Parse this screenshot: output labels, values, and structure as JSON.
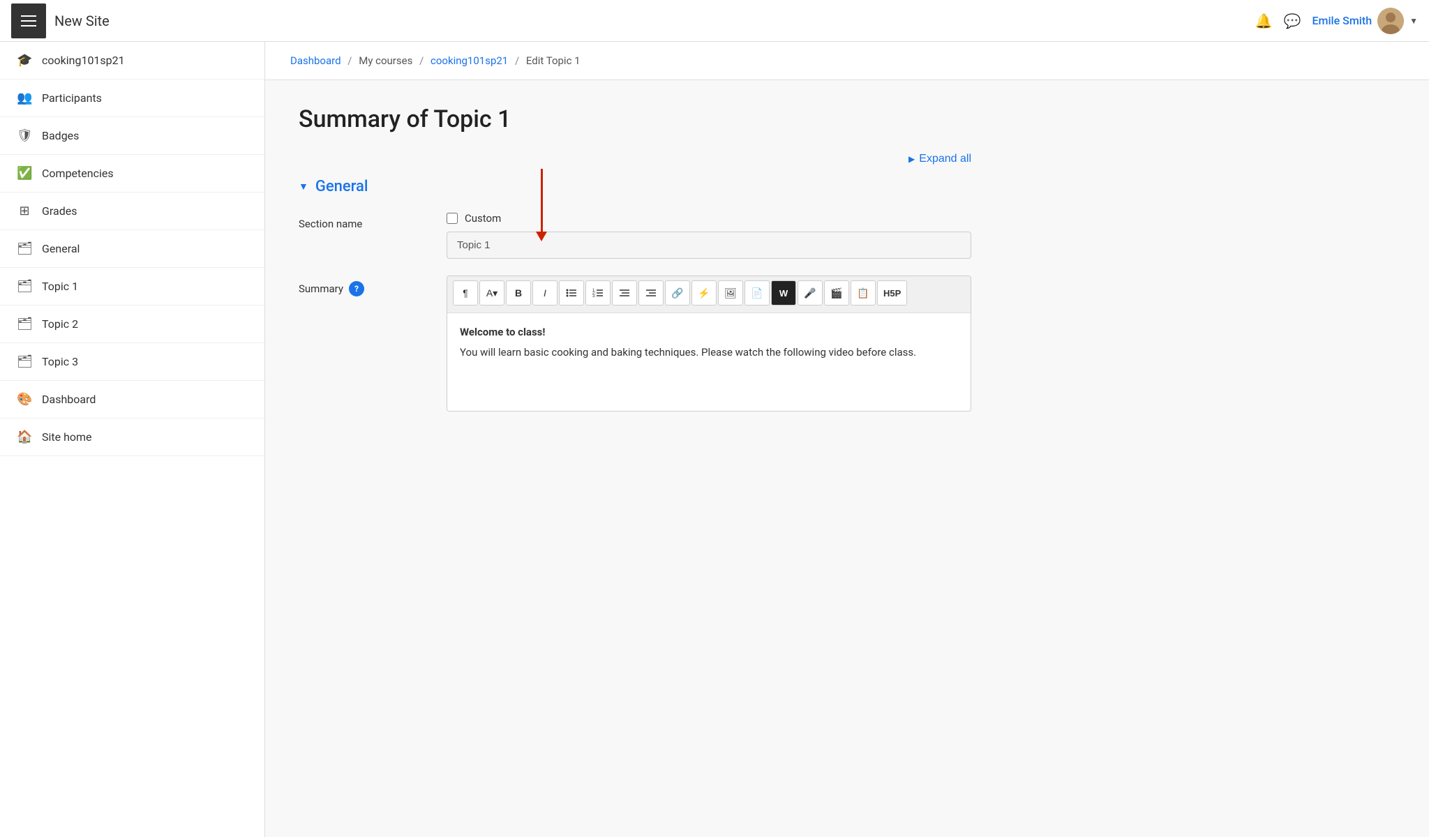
{
  "topbar": {
    "site_title": "New Site",
    "user_name": "Emile Smith",
    "notification_icon": "🔔",
    "message_icon": "💬",
    "dropdown_arrow": "▼"
  },
  "sidebar": {
    "items": [
      {
        "id": "cooking101sp21",
        "label": "cooking101sp21",
        "icon": "🎓"
      },
      {
        "id": "participants",
        "label": "Participants",
        "icon": "👥"
      },
      {
        "id": "badges",
        "label": "Badges",
        "icon": "🛡"
      },
      {
        "id": "competencies",
        "label": "Competencies",
        "icon": "✅"
      },
      {
        "id": "grades",
        "label": "Grades",
        "icon": "⊞"
      },
      {
        "id": "general",
        "label": "General",
        "icon": "🗂"
      },
      {
        "id": "topic1",
        "label": "Topic 1",
        "icon": "🗂"
      },
      {
        "id": "topic2",
        "label": "Topic 2",
        "icon": "🗂"
      },
      {
        "id": "topic3",
        "label": "Topic 3",
        "icon": "🗂"
      },
      {
        "id": "dashboard",
        "label": "Dashboard",
        "icon": "🎨"
      },
      {
        "id": "sitehome",
        "label": "Site home",
        "icon": "🏠"
      }
    ]
  },
  "breadcrumb": {
    "items": [
      {
        "label": "Dashboard",
        "href": "#",
        "link": true
      },
      {
        "label": "My courses",
        "href": "#",
        "link": false
      },
      {
        "label": "cooking101sp21",
        "href": "#",
        "link": true
      },
      {
        "label": "Edit Topic 1",
        "href": "#",
        "link": false
      }
    ]
  },
  "page": {
    "title": "Summary of Topic 1",
    "expand_all_label": "Expand all",
    "section_title": "General",
    "form": {
      "section_name_label": "Section name",
      "custom_label": "Custom",
      "section_input_value": "Topic 1",
      "summary_label": "Summary",
      "editor_content_bold": "Welcome to class!",
      "editor_content_normal": "You will learn basic cooking and baking techniques. Please watch the following video before class."
    },
    "toolbar": {
      "row1": [
        {
          "id": "format",
          "label": "¶"
        },
        {
          "id": "font-size",
          "label": "A▾"
        },
        {
          "id": "bold",
          "label": "B"
        },
        {
          "id": "italic",
          "label": "I"
        },
        {
          "id": "bullet-list",
          "label": "≡"
        },
        {
          "id": "ordered-list",
          "label": "≡·"
        },
        {
          "id": "outdent",
          "label": "⇤"
        },
        {
          "id": "indent",
          "label": "⇥"
        },
        {
          "id": "link",
          "label": "🔗"
        },
        {
          "id": "special",
          "label": "⚡"
        }
      ],
      "row2": [
        {
          "id": "image",
          "label": "🖼"
        },
        {
          "id": "media",
          "label": "📄"
        },
        {
          "id": "word",
          "label": "W",
          "dark": true
        },
        {
          "id": "audio",
          "label": "🎤"
        },
        {
          "id": "video",
          "label": "🎬"
        },
        {
          "id": "copy",
          "label": "📋"
        },
        {
          "id": "h5p",
          "label": "H5P"
        }
      ]
    }
  }
}
